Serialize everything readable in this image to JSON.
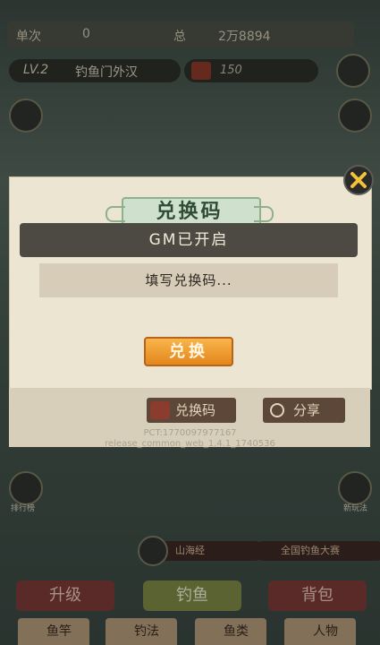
{
  "top": {
    "single_label": "单次",
    "single_value": "0",
    "total_label": "总",
    "total_value": "2万8894",
    "level": "LV.2",
    "title_name": "钓鱼门外汉",
    "bait_count": "150"
  },
  "side": {
    "left_label": "排行榜",
    "right_label": "新玩法"
  },
  "bottom": {
    "upgrade": "升级",
    "fishing": "钓鱼",
    "bag": "背包",
    "pill_left": "山海经",
    "pill_right": "全国钓鱼大赛",
    "tabs": [
      "鱼竿",
      "钓法",
      "鱼类",
      "人物"
    ]
  },
  "modal": {
    "title": "兑换码",
    "gm_status": "GM已开启",
    "input_placeholder": "填写兑换码...",
    "redeem_button": "兑换"
  },
  "footer": {
    "redeem_code_button": "兑换码",
    "share_button": "分享",
    "pct": "PCT:1770097977167",
    "release": "release_common_web_1.4.1_1740536"
  },
  "colors": {
    "accent_orange": "#f0a031",
    "dark_bar": "#4d4a44",
    "modal_bg": "#ece5d1"
  },
  "icons": [
    "settings-icon",
    "scroll-icon",
    "bait-icon",
    "close-icon",
    "yin-yang-icon",
    "share-icon",
    "chest-icon"
  ]
}
